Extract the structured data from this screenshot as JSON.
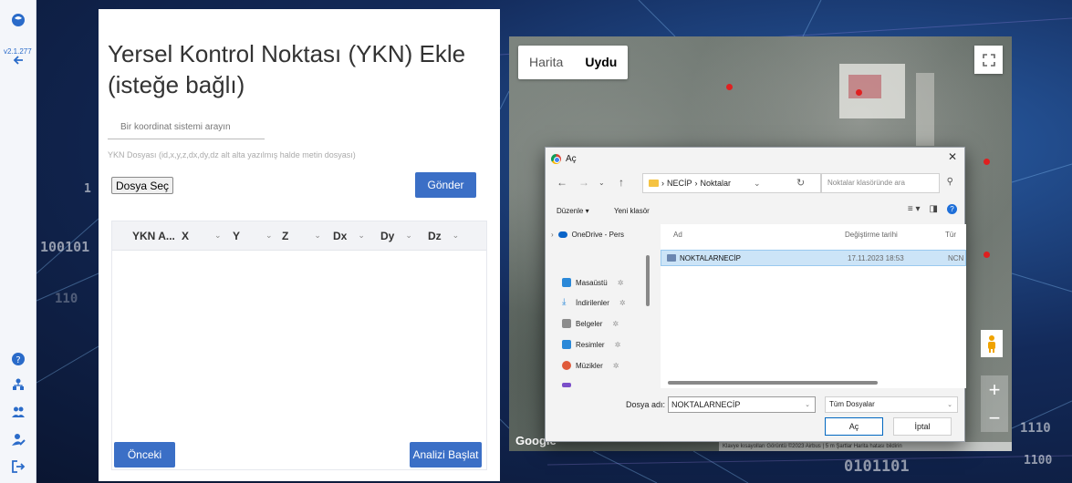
{
  "app": {
    "version": "v2.1.277"
  },
  "rail": {
    "icons": [
      "logo-icon",
      "back-arrow-icon",
      "help-icon",
      "network-icon",
      "users-icon",
      "user-settings-icon",
      "logout-icon"
    ]
  },
  "panel": {
    "title": "Yersel Kontrol Noktası (YKN) Ekle (isteğe bağlı)",
    "coord_search_placeholder": "Bir koordinat sistemi arayın",
    "ykn_hint": "YKN Dosyası (id,x,y,z,dx,dy,dz alt alta yazılmış halde metin dosyası)",
    "choose_file_label": "Dosya Seç",
    "send_label": "Gönder",
    "grid_columns": [
      "YKN A...",
      "X",
      "Y",
      "Z",
      "Dx",
      "Dy",
      "Dz"
    ],
    "prev_label": "Önceki",
    "start_label": "Analizi Başlat"
  },
  "map": {
    "tabs": [
      "Harita",
      "Uydu"
    ],
    "active_tab": "Uydu",
    "google_label": "Google",
    "footer_text": "Klavye kısayolları   Görüntü ©2023 Airbus | 5 m   Şartlar   Harita hatası bildirin"
  },
  "dialog": {
    "title": "Aç",
    "breadcrumb": [
      "NECİP",
      "Noktalar"
    ],
    "search_placeholder": "Noktalar klasöründe ara",
    "toolbar": {
      "organize": "Düzenle ▾",
      "new_folder": "Yeni klasör"
    },
    "nav_items": [
      {
        "label": "OneDrive - Pers",
        "icon": "onedrive-icon",
        "color": "#0a64c8"
      },
      {
        "label": "Masaüstü",
        "icon": "desktop-icon",
        "color": "#2a88d8"
      },
      {
        "label": "İndirilenler",
        "icon": "downloads-icon",
        "color": "#2a88d8"
      },
      {
        "label": "Belgeler",
        "icon": "documents-icon",
        "color": "#8c8c8c"
      },
      {
        "label": "Resimler",
        "icon": "pictures-icon",
        "color": "#2a88d8"
      },
      {
        "label": "Müzikler",
        "icon": "music-icon",
        "color": "#e05a3a"
      }
    ],
    "columns": {
      "name": "Ad",
      "date": "Değiştirme tarihi",
      "type": "Tür"
    },
    "files": [
      {
        "name": "NOKTALARNECİP",
        "date": "17.11.2023 18:53",
        "type": "NCN"
      }
    ],
    "file_name_label": "Dosya adı:",
    "file_name_value": "NOKTALARNECİP",
    "file_type": "Tüm Dosyalar",
    "open_label": "Aç",
    "cancel_label": "İptal"
  },
  "background": {
    "texts": [
      "100101",
      "110",
      "1100",
      "0101101",
      "1110",
      "1"
    ]
  },
  "colors": {
    "primary": "#3b6fc6",
    "rail_icon": "#2a6bc9",
    "marker": "#e02020"
  }
}
